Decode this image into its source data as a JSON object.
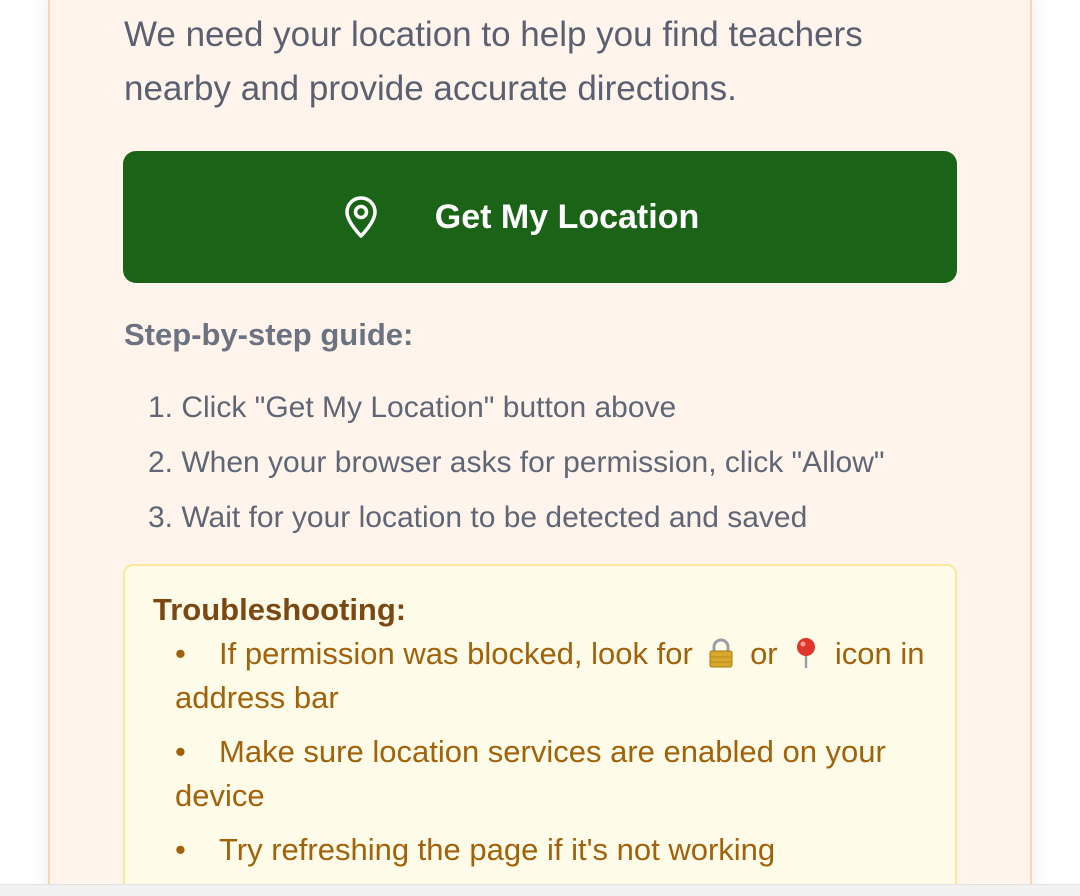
{
  "intro_text": "We need your location to help you find teachers nearby and provide accurate directions.",
  "location_button": {
    "label": "Get My Location",
    "icon": "map-pin-icon",
    "color": "#1b6417"
  },
  "guide": {
    "title": "Step-by-step guide:",
    "steps": [
      "1. Click \"Get My Location\" button above",
      "2. When your browser asks for permission, click \"Allow\"",
      "3. Wait for your location to be detected and saved"
    ]
  },
  "troubleshooting": {
    "title": "Troubleshooting:",
    "bullet": "•",
    "item1_before": "If permission was blocked, look for",
    "item1_or": "or",
    "item1_after": "icon in address bar",
    "item1_icons": [
      "lock-icon",
      "pushpin-icon"
    ],
    "item2": "Make sure location services are enabled on your device",
    "item3": "Try refreshing the page if it's not working"
  },
  "colors": {
    "card_background": "#fff4eb",
    "tip_background": "#fefbe8",
    "tip_text": "#a1620b"
  }
}
